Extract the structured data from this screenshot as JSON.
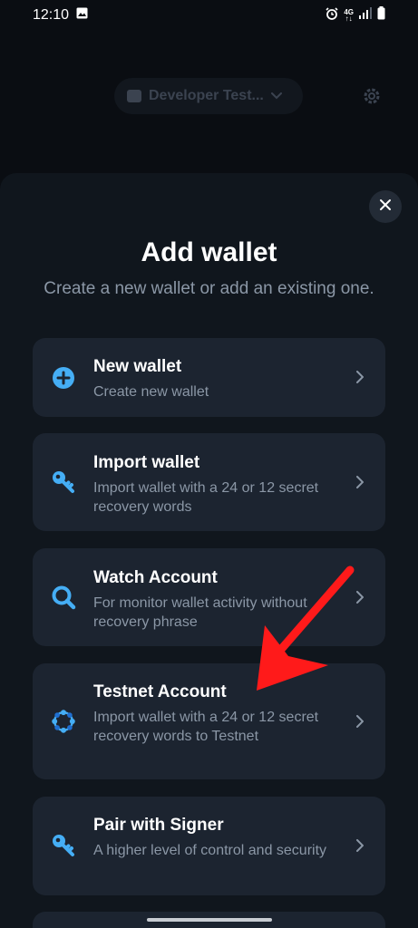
{
  "status_bar": {
    "time": "12:10",
    "net_top": "4G",
    "net_bottom": "↑↓"
  },
  "behind": {
    "wallet_name": "Developer Test...",
    "icons": [
      "wallet-icon",
      "chevron-down-icon",
      "gear-icon"
    ]
  },
  "sheet": {
    "title": "Add wallet",
    "subtitle": "Create a new wallet or add an existing one.",
    "options": [
      {
        "title": "New wallet",
        "description": "Create new wallet",
        "icon": "plus-circle-icon"
      },
      {
        "title": "Import wallet",
        "description": "Import wallet with a 24 or 12 secret recovery words",
        "icon": "key-icon"
      },
      {
        "title": "Watch Account",
        "description": "For monitor wallet activity without recovery phrase",
        "icon": "magnifier-icon"
      },
      {
        "title": "Testnet Account",
        "description": "Import wallet with a 24 or 12 secret recovery words to Testnet",
        "icon": "testnet-dots-icon"
      },
      {
        "title": "Pair with Signer",
        "description": "A higher level of control and security",
        "icon": "key-icon"
      }
    ]
  },
  "colors": {
    "background": "#0a0d12",
    "sheet": "#10161d",
    "card": "#1c2430",
    "accent": "#45aef5",
    "secondary_text": "#8b97a6",
    "annotation_arrow": "#ff1a1a"
  }
}
